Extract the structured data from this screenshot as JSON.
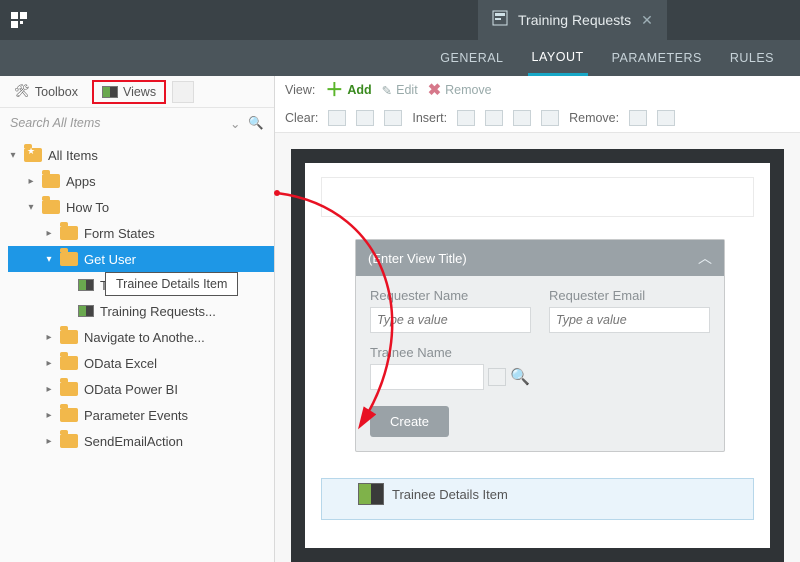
{
  "topbar": {
    "tab_title": "Training Requests"
  },
  "subtabs": {
    "general": "GENERAL",
    "layout": "LAYOUT",
    "parameters": "PARAMETERS",
    "rules": "RULES"
  },
  "sidebar": {
    "toolbox": "Toolbox",
    "views": "Views",
    "search_placeholder": "Search All Items",
    "tree": {
      "all_items": "All Items",
      "apps": "Apps",
      "how_to": "How To",
      "form_states": "Form States",
      "get_user": "Get User",
      "trainee_item": "Trainee Details It...",
      "training_requests": "Training Requests...",
      "navigate": "Navigate to Anothe...",
      "odata_excel": "OData Excel",
      "odata_pbi": "OData Power BI",
      "param_events": "Parameter Events",
      "send_email": "SendEmailAction"
    },
    "callout": "Trainee Details Item"
  },
  "toolbar": {
    "view": "View:",
    "add": "Add",
    "edit": "Edit",
    "remove": "Remove",
    "clear": "Clear:",
    "insert": "Insert:",
    "remove2": "Remove:"
  },
  "card": {
    "title": "(Enter View Title)",
    "req_name": "Requester Name",
    "req_email": "Requester Email",
    "trainee_name": "Trainee Name",
    "placeholder": "Type a value",
    "create": "Create"
  },
  "drop": {
    "label": "Trainee Details Item"
  }
}
